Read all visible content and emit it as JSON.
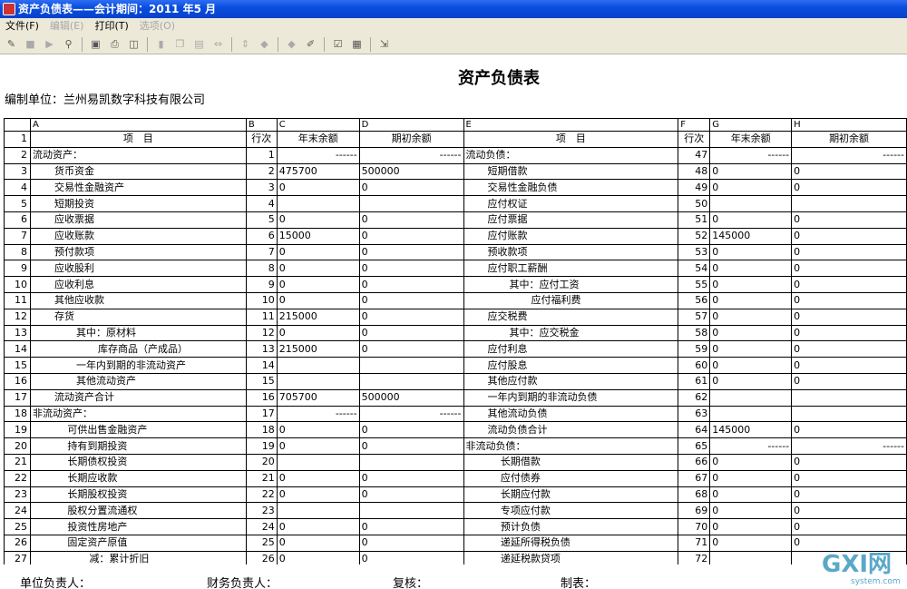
{
  "window": {
    "title": "资产负债表——会计期间：2011 年5 月"
  },
  "menu": [
    {
      "label": "文件(F)",
      "enabled": true
    },
    {
      "label": "编辑(E)",
      "enabled": false
    },
    {
      "label": "打印(T)",
      "enabled": true
    },
    {
      "label": "选项(O)",
      "enabled": false
    }
  ],
  "toolbar": [
    "open-icon",
    "stop-icon",
    "play-icon",
    "find-icon",
    "save-icon",
    "print-icon",
    "preview-icon",
    "cut-icon",
    "copy-icon",
    "paste-icon",
    "zoom-icon",
    "resize-icon",
    "prev-icon",
    "next-icon",
    "edit-icon",
    "check-icon",
    "grid-icon",
    "exit-icon"
  ],
  "report": {
    "title": "资产负债表",
    "unit": "编制单位：兰州易凯数字科技有限公司"
  },
  "columns": [
    "A",
    "B",
    "C",
    "D",
    "E",
    "F",
    "G",
    "H"
  ],
  "rows": [
    {
      "n": "1",
      "a": "项　目",
      "b": "行次",
      "c": "年末余额",
      "d": "期初余额",
      "e": "项　目",
      "f": "行次",
      "g": "年末余额",
      "h": "期初余额",
      "hdr": true
    },
    {
      "n": "2",
      "a": "流动资产：",
      "b": "1",
      "c": "------",
      "d": "------",
      "e": "流动负债：",
      "f": "47",
      "g": "------",
      "h": "------",
      "ai": 0,
      "ei": 0,
      "dash": true
    },
    {
      "n": "3",
      "a": "货币资金",
      "b": "2",
      "c": "475700",
      "d": "500000",
      "e": "短期借款",
      "f": "48",
      "g": "0",
      "h": "0",
      "ai": 1,
      "ei": 1
    },
    {
      "n": "4",
      "a": "交易性金融资产",
      "b": "3",
      "c": "0",
      "d": "0",
      "e": "交易性金融负债",
      "f": "49",
      "g": "0",
      "h": "0",
      "ai": 1,
      "ei": 1
    },
    {
      "n": "5",
      "a": "短期投资",
      "b": "4",
      "c": "",
      "d": "",
      "e": "应付权证",
      "f": "50",
      "g": "",
      "h": "",
      "ai": 1,
      "ei": 1
    },
    {
      "n": "6",
      "a": "应收票据",
      "b": "5",
      "c": "0",
      "d": "0",
      "e": "应付票据",
      "f": "51",
      "g": "0",
      "h": "0",
      "ai": 1,
      "ei": 1
    },
    {
      "n": "7",
      "a": "应收账款",
      "b": "6",
      "c": "15000",
      "d": "0",
      "e": "应付账款",
      "f": "52",
      "g": "145000",
      "h": "0",
      "ai": 1,
      "ei": 1
    },
    {
      "n": "8",
      "a": "预付款项",
      "b": "7",
      "c": "0",
      "d": "0",
      "e": "预收款项",
      "f": "53",
      "g": "0",
      "h": "0",
      "ai": 1,
      "ei": 1
    },
    {
      "n": "9",
      "a": "应收股利",
      "b": "8",
      "c": "0",
      "d": "0",
      "e": "应付职工薪酬",
      "f": "54",
      "g": "0",
      "h": "0",
      "ai": 1,
      "ei": 1
    },
    {
      "n": "10",
      "a": "应收利息",
      "b": "9",
      "c": "0",
      "d": "0",
      "e": "其中：应付工资",
      "f": "55",
      "g": "0",
      "h": "0",
      "ai": 1,
      "ei": 2
    },
    {
      "n": "11",
      "a": "其他应收款",
      "b": "10",
      "c": "0",
      "d": "0",
      "e": "应付福利费",
      "f": "56",
      "g": "0",
      "h": "0",
      "ai": 1,
      "ei": 3
    },
    {
      "n": "12",
      "a": "存货",
      "b": "11",
      "c": "215000",
      "d": "0",
      "e": "应交税费",
      "f": "57",
      "g": "0",
      "h": "0",
      "ai": 1,
      "ei": 1
    },
    {
      "n": "13",
      "a": "其中：原材料",
      "b": "12",
      "c": "0",
      "d": "0",
      "e": "其中：应交税金",
      "f": "58",
      "g": "0",
      "h": "0",
      "ai": 2,
      "ei": 2
    },
    {
      "n": "14",
      "a": "库存商品（产成品）",
      "b": "13",
      "c": "215000",
      "d": "0",
      "e": "应付利息",
      "f": "59",
      "g": "0",
      "h": "0",
      "ai": 3,
      "ei": 1
    },
    {
      "n": "15",
      "a": "一年内到期的非流动资产",
      "b": "14",
      "c": "",
      "d": "",
      "e": "应付股息",
      "f": "60",
      "g": "0",
      "h": "0",
      "ai": 2,
      "ei": 1
    },
    {
      "n": "16",
      "a": "其他流动资产",
      "b": "15",
      "c": "",
      "d": "",
      "e": "其他应付款",
      "f": "61",
      "g": "0",
      "h": "0",
      "ai": 2,
      "ei": 1
    },
    {
      "n": "17",
      "a": "流动资产合计",
      "b": "16",
      "c": "705700",
      "d": "500000",
      "e": "一年内到期的非流动负债",
      "f": "62",
      "g": "",
      "h": "",
      "ai": 1,
      "ei": 1
    },
    {
      "n": "18",
      "a": "非流动资产：",
      "b": "17",
      "c": "------",
      "d": "------",
      "e": "其他流动负债",
      "f": "63",
      "g": "",
      "h": "",
      "ai": 0,
      "ei": 1,
      "dashcd": true
    },
    {
      "n": "19",
      "a": "可供出售金融资产",
      "b": "18",
      "c": "0",
      "d": "0",
      "e": "流动负债合计",
      "f": "64",
      "g": "145000",
      "h": "0",
      "ai": 1.6,
      "ei": 1
    },
    {
      "n": "20",
      "a": "持有到期投资",
      "b": "19",
      "c": "0",
      "d": "0",
      "e": "非流动负债：",
      "f": "65",
      "g": "------",
      "h": "------",
      "ai": 1.6,
      "ei": 0,
      "dashgh": true
    },
    {
      "n": "21",
      "a": "长期债权投资",
      "b": "20",
      "c": "",
      "d": "",
      "e": "长期借款",
      "f": "66",
      "g": "0",
      "h": "0",
      "ai": 1.6,
      "ei": 1.6
    },
    {
      "n": "22",
      "a": "长期应收款",
      "b": "21",
      "c": "0",
      "d": "0",
      "e": "应付债券",
      "f": "67",
      "g": "0",
      "h": "0",
      "ai": 1.6,
      "ei": 1.6
    },
    {
      "n": "23",
      "a": "长期股权投资",
      "b": "22",
      "c": "0",
      "d": "0",
      "e": "长期应付款",
      "f": "68",
      "g": "0",
      "h": "0",
      "ai": 1.6,
      "ei": 1.6
    },
    {
      "n": "24",
      "a": "股权分置流通权",
      "b": "23",
      "c": "",
      "d": "",
      "e": "专项应付款",
      "f": "69",
      "g": "0",
      "h": "0",
      "ai": 1.6,
      "ei": 1.6
    },
    {
      "n": "25",
      "a": "投资性房地产",
      "b": "24",
      "c": "0",
      "d": "0",
      "e": "预计负债",
      "f": "70",
      "g": "0",
      "h": "0",
      "ai": 1.6,
      "ei": 1.6
    },
    {
      "n": "26",
      "a": "固定资产原值",
      "b": "25",
      "c": "0",
      "d": "0",
      "e": "递延所得税负债",
      "f": "71",
      "g": "0",
      "h": "0",
      "ai": 1.6,
      "ei": 1.6
    },
    {
      "n": "27",
      "a": "减：累计折旧",
      "b": "26",
      "c": "0",
      "d": "0",
      "e": "递延税款贷项",
      "f": "72",
      "g": "",
      "h": "",
      "ai": 2.6,
      "ei": 1.6
    }
  ],
  "footer": {
    "head": "单位负责人：",
    "finance": "财务负责人：",
    "review": "复核：",
    "maker": "制表："
  },
  "watermark": {
    "main": "GXI网",
    "sub": "system.com"
  }
}
